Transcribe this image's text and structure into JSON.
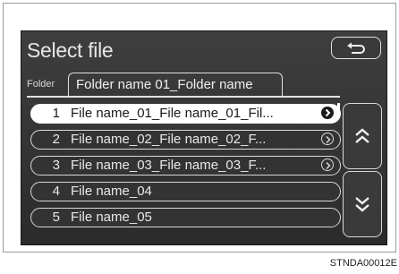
{
  "screen": {
    "title": "Select file",
    "folder_label": "Folder",
    "folder_name": "Folder name 01_Folder name",
    "files": [
      {
        "number": "1",
        "name": "File name_01_File name_01_Fil...",
        "selected": true,
        "has_play": true
      },
      {
        "number": "2",
        "name": "File name_02_File name_02_F...",
        "selected": false,
        "has_play": true
      },
      {
        "number": "3",
        "name": "File name_03_File name_03_F...",
        "selected": false,
        "has_play": true
      },
      {
        "number": "4",
        "name": "File name_04",
        "selected": false,
        "has_play": false
      },
      {
        "number": "5",
        "name": "File name_05",
        "selected": false,
        "has_play": false
      }
    ],
    "icons": {
      "back": "back-arrow-icon",
      "scroll_up": "double-chevron-up-icon",
      "scroll_down": "double-chevron-down-icon",
      "play": "play-circle-icon"
    }
  },
  "figure_code": "STNDA00012E"
}
